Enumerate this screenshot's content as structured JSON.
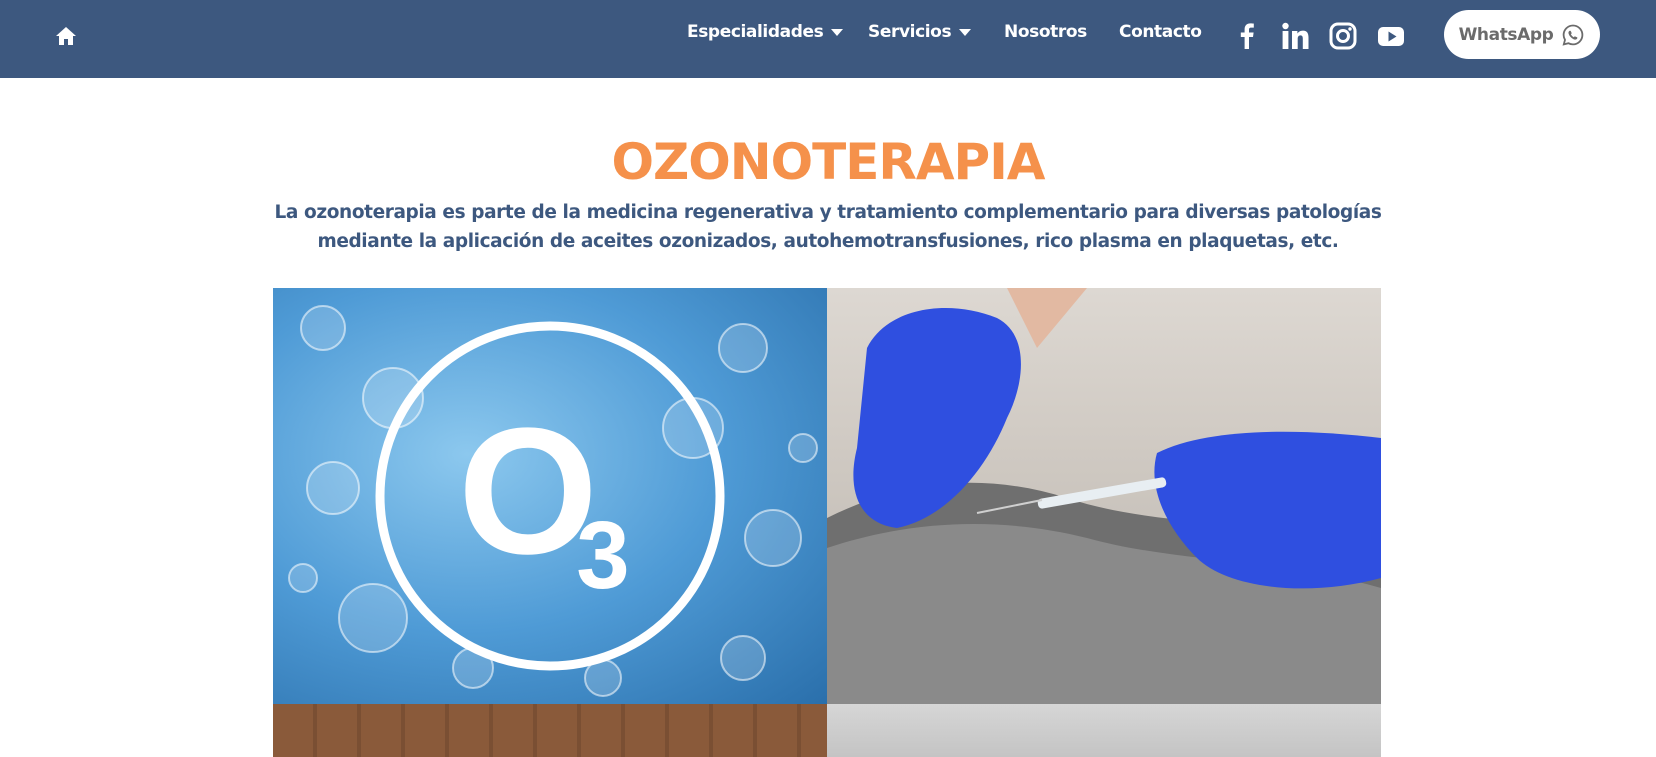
{
  "nav": {
    "home_icon": "home-icon",
    "items": [
      {
        "label": "Especialidades",
        "has_dropdown": true
      },
      {
        "label": "Servicios",
        "has_dropdown": true
      },
      {
        "label": "Nosotros",
        "has_dropdown": false
      },
      {
        "label": "Contacto",
        "has_dropdown": false
      }
    ],
    "social_icons": [
      "facebook-icon",
      "linkedin-icon",
      "instagram-icon",
      "youtube-icon"
    ],
    "whatsapp_label": "WhatsApp",
    "colors": {
      "bar": "#3d587f",
      "text": "#ffffff",
      "button_bg": "#ffffff",
      "button_text": "#6b6b6b"
    }
  },
  "main": {
    "title": "OZONOTERAPIA",
    "intro": "La ozonoterapia es parte de la medicina regenerativa y tratamiento complementario para diversas patologías mediante la aplicación de aceites ozonizados, autohemotransfusiones, rico plasma en plaquetas, etc.",
    "colors": {
      "title": "#f5914b",
      "intro": "#3d587f"
    }
  },
  "gallery": {
    "ozone_symbol": "O",
    "ozone_subscript": "3"
  }
}
